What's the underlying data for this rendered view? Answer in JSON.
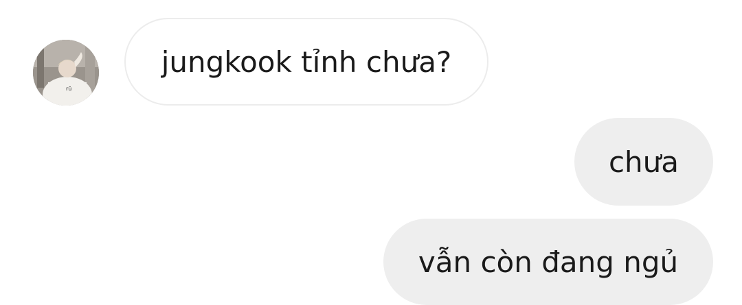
{
  "conversation": {
    "messages": [
      {
        "sender": "other",
        "text": "jungkook tỉnh chưa?"
      },
      {
        "sender": "me",
        "text": "chưa"
      },
      {
        "sender": "me",
        "text": "vẫn còn đang ngủ"
      }
    ]
  },
  "colors": {
    "page_background": "#ffffff",
    "incoming_bubble_background": "#ffffff",
    "incoming_bubble_border": "#ececec",
    "outgoing_bubble_background": "#eeeeee",
    "text": "#1a1a1a"
  }
}
